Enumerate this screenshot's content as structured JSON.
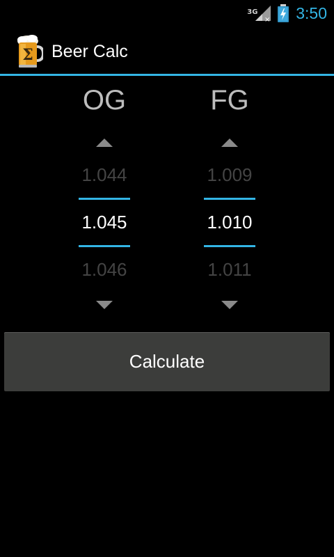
{
  "status_bar": {
    "network_label": "3G",
    "time": "3:50",
    "accent_color": "#33b5e5"
  },
  "action_bar": {
    "title": "Beer Calc",
    "icon": "beer-mug-icon"
  },
  "pickers": {
    "og": {
      "label": "OG",
      "prev": "1.044",
      "current": "1.045",
      "next": "1.046"
    },
    "fg": {
      "label": "FG",
      "prev": "1.009",
      "current": "1.010",
      "next": "1.011"
    }
  },
  "calculate_button": {
    "label": "Calculate"
  }
}
